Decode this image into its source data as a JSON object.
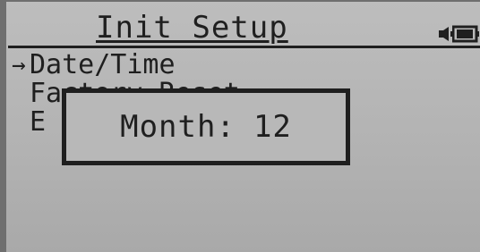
{
  "screen": {
    "title": "Init Setup"
  },
  "status_icons": [
    "speaker-icon",
    "battery-icon"
  ],
  "menu": {
    "cursor": "→",
    "items": [
      {
        "label": "Date/Time",
        "selected": true
      },
      {
        "label": "Factory Reset",
        "selected": false
      },
      {
        "label": "E",
        "selected": false
      }
    ]
  },
  "dialog": {
    "label": "Month:",
    "value": "12"
  },
  "colors": {
    "lcd_background": "#b5b5b5",
    "text": "#1f1f1f",
    "bezel": "#6f6f6f"
  }
}
